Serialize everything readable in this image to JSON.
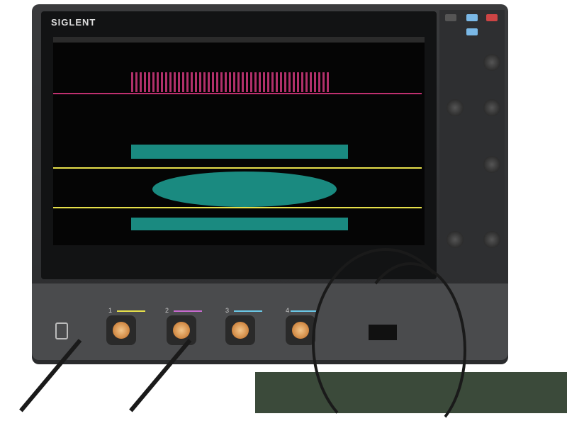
{
  "brand": "SIGLENT",
  "channels": [
    {
      "label": "1",
      "color": "#e6e04a"
    },
    {
      "label": "2",
      "color": "#c86ad0"
    },
    {
      "label": "3",
      "color": "#6ac8e6"
    },
    {
      "label": "4",
      "color": "#6ac8e6"
    }
  ]
}
